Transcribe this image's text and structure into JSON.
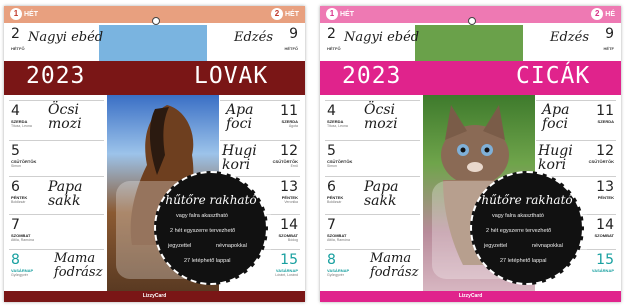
{
  "calendars": [
    {
      "theme": "horse",
      "colors": {
        "strip": "#e8a07f",
        "band": "#7a1616",
        "footer": "#7a1616",
        "sky": "#7ab4e0",
        "photo_top": "#3a6fc5",
        "photo_bottom": "#8b5a32"
      },
      "week_left": "1",
      "week_left_label": "HÉT",
      "week_right": "2",
      "week_right_label": "HÉT",
      "top_left_day": "2",
      "top_left_dayname": "HÉTFŐ",
      "top_left_text": "Nagyi ebéd",
      "top_right_text": "Edzés",
      "top_right_day": "9",
      "top_right_dayname": "HÉTFŐ",
      "year": "2023",
      "title": "LOVAK",
      "left_days": [
        {
          "num": "4",
          "name": "SZERDA",
          "saint": "Titusz, Leona",
          "note": "Öcsi mozi"
        },
        {
          "num": "5",
          "name": "CSÜTÖRTÖK",
          "saint": "Simon",
          "note": ""
        },
        {
          "num": "6",
          "name": "PÉNTEK",
          "saint": "Boldizsár",
          "note": "Papa sakk"
        },
        {
          "num": "7",
          "name": "SZOMBAT",
          "saint": "Attila, Ramóna",
          "note": ""
        },
        {
          "num": "8",
          "name": "VASÁRNAP",
          "saint": "Gyöngyvér",
          "note": "Mama fodrász"
        }
      ],
      "right_days": [
        {
          "num": "11",
          "name": "SZERDA",
          "saint": "Ágota",
          "note": "Apa foci"
        },
        {
          "num": "12",
          "name": "CSÜTÖRTÖK",
          "saint": "Ernő",
          "note": "Hugi kori"
        },
        {
          "num": "13",
          "name": "PÉNTEK",
          "saint": "Veronika",
          "note": ""
        },
        {
          "num": "14",
          "name": "SZOMBAT",
          "saint": "Bódog",
          "note": ""
        },
        {
          "num": "15",
          "name": "VASÁRNAP",
          "saint": "Lóránt, Loránd",
          "note": ""
        }
      ],
      "circle_title": "hűtőre rakható",
      "features": [
        "vagy falra akasztható",
        "2 hét egyszerre tervezhető",
        "jegyzettel",
        "névnapokkal",
        "27 letéphető lappal"
      ],
      "brand": "LizzyCard"
    },
    {
      "theme": "cat",
      "colors": {
        "strip": "#ee79b3",
        "band": "#e0238c",
        "footer": "#e0238c",
        "sky": "#6aa14a",
        "photo_top": "#3e7a2c",
        "photo_bottom": "#b88b9a"
      },
      "week_left": "1",
      "week_left_label": "HÉT",
      "week_right": "2",
      "week_right_label": "HÉ",
      "top_left_day": "2",
      "top_left_dayname": "HÉTFŐ",
      "top_left_text": "Nagyi ebéd",
      "top_right_text": "Edzés",
      "top_right_day": "9",
      "top_right_dayname": "HÉTF",
      "year": "2023",
      "title": "CICÁK",
      "left_days": [
        {
          "num": "4",
          "name": "SZERDA",
          "saint": "Titusz, Leona",
          "note": "Öcsi mozi"
        },
        {
          "num": "5",
          "name": "CSÜTÖRTÖK",
          "saint": "Simon",
          "note": ""
        },
        {
          "num": "6",
          "name": "PÉNTEK",
          "saint": "Boldizsár",
          "note": "Papa sakk"
        },
        {
          "num": "7",
          "name": "SZOMBAT",
          "saint": "Attila, Ramóna",
          "note": ""
        },
        {
          "num": "8",
          "name": "VASÁRNAP",
          "saint": "Gyöngyvér",
          "note": "Mama fodrász"
        }
      ],
      "right_days": [
        {
          "num": "11",
          "name": "SZERDA",
          "saint": "",
          "note": "Apa foci"
        },
        {
          "num": "12",
          "name": "CSÜTÖRTÖK",
          "saint": "",
          "note": "Hugi kori"
        },
        {
          "num": "13",
          "name": "PÉNTEK",
          "saint": "",
          "note": ""
        },
        {
          "num": "14",
          "name": "SZOMBAT",
          "saint": "",
          "note": ""
        },
        {
          "num": "15",
          "name": "VASÁRNAP",
          "saint": "",
          "note": ""
        }
      ],
      "circle_title": "hűtőre rakható",
      "features": [
        "vagy falra akasztható",
        "2 hét egyszerre tervezhető",
        "jegyzettel",
        "névnapokkal",
        "27 letéphető lappal"
      ],
      "brand": "LizzyCard"
    }
  ]
}
